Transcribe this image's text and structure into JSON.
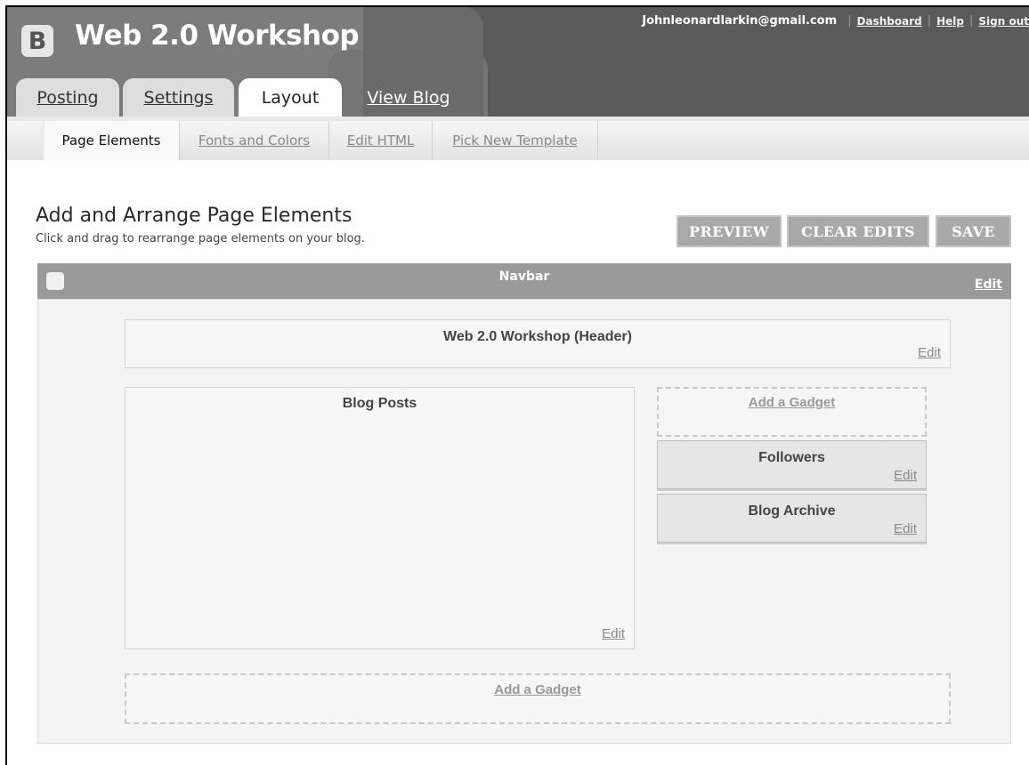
{
  "header": {
    "logo_glyph": "B",
    "app_title": "Web 2.0 Workshop",
    "email": "Johnleonardlarkin@gmail.com",
    "links": {
      "dashboard": "Dashboard",
      "help": "Help",
      "sign_out": "Sign out"
    },
    "separator": "|"
  },
  "tabs": [
    {
      "label": "Posting",
      "state": "inactive"
    },
    {
      "label": "Settings",
      "state": "inactive"
    },
    {
      "label": "Layout",
      "state": "active"
    },
    {
      "label": "View Blog",
      "state": "link"
    }
  ],
  "subtabs": [
    {
      "label": "Page Elements",
      "state": "active"
    },
    {
      "label": "Fonts and Colors",
      "state": "link"
    },
    {
      "label": "Edit HTML",
      "state": "link"
    },
    {
      "label": "Pick New Template",
      "state": "link"
    }
  ],
  "page": {
    "title": "Add and Arrange Page Elements",
    "subtitle": "Click and drag to rearrange page elements on your blog."
  },
  "actions": {
    "preview": "PREVIEW",
    "clear_edits": "CLEAR EDITS",
    "save": "SAVE"
  },
  "layout": {
    "navbar": {
      "title": "Navbar",
      "edit": "Edit"
    },
    "header_element": {
      "title": "Web 2.0 Workshop (Header)",
      "edit": "Edit"
    },
    "blog_posts": {
      "title": "Blog Posts",
      "edit": "Edit"
    },
    "sidebar_add_gadget": "Add a Gadget",
    "sidebar_widgets": [
      {
        "title": "Followers",
        "edit": "Edit"
      },
      {
        "title": "Blog Archive",
        "edit": "Edit"
      }
    ],
    "footer_add_gadget": "Add a Gadget"
  },
  "colors": {
    "header_bg": "#5a5a5a",
    "navbar_bg": "#9a9a9a",
    "button_bg": "#a9a9a9"
  }
}
